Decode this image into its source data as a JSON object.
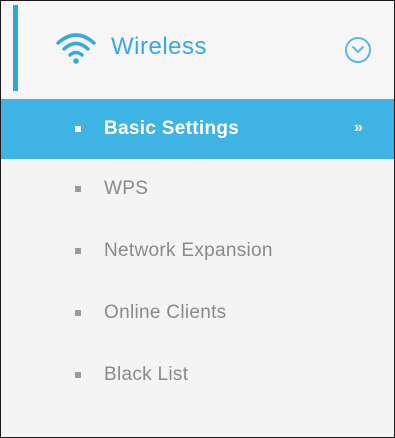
{
  "colors": {
    "accent": "#3fb3e3",
    "header_text": "#3aa8dd",
    "item_text": "#8a8a8a",
    "background": "#f4f4f4"
  },
  "header": {
    "icon": "wifi-icon",
    "label": "Wireless",
    "toggle_icon": "chevron-down-circle-icon"
  },
  "menu": {
    "items": [
      {
        "label": "Basic Settings",
        "active": true,
        "arrow": "»"
      },
      {
        "label": "WPS",
        "active": false
      },
      {
        "label": "Network Expansion",
        "active": false
      },
      {
        "label": "Online Clients",
        "active": false
      },
      {
        "label": "Black List",
        "active": false
      }
    ]
  }
}
